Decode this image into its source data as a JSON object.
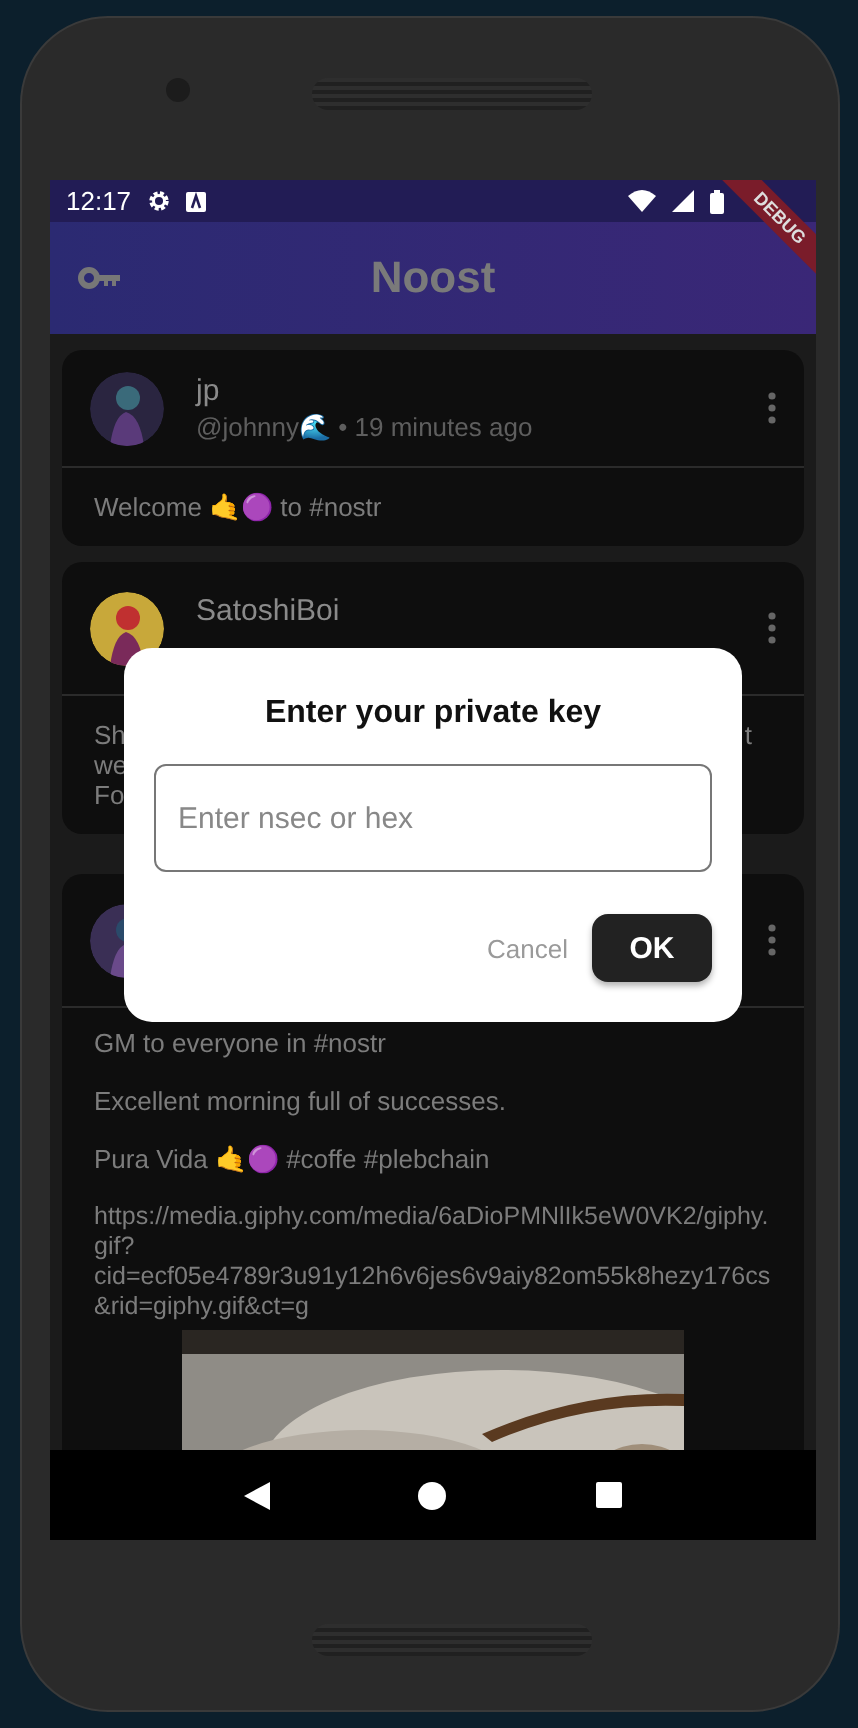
{
  "status_bar": {
    "time": "12:17"
  },
  "debug_banner": "DEBUG",
  "app_bar": {
    "title": "Noost"
  },
  "posts": [
    {
      "name": "jp",
      "meta": "@johnny🌊 • 19 minutes ago",
      "body": [
        "Welcome 🤙🟣 to #nostr"
      ]
    },
    {
      "name": "SatoshiBoi",
      "fragments": [
        {
          "left": "Sh",
          "right": "t"
        },
        {
          "left": "we"
        },
        {
          "left": "Fo"
        }
      ]
    },
    {
      "body": [
        "GM to everyone in #nostr",
        "Excellent morning full of successes.",
        "Pura Vida 🤙🟣 #coffe #plebchain",
        "https://media.giphy.com/media/6aDioPMNlIk5eW0VK2/giphy.gif?cid=ecf05e4789r3u91y12h6v6jes6v9aiy82om55k8hezy176cs&rid=giphy.gif&ct=g"
      ]
    }
  ],
  "dialog": {
    "title": "Enter your private key",
    "field": {
      "placeholder": "Enter nsec or hex"
    },
    "buttons": [
      {
        "label": "Cancel",
        "kind": "text"
      },
      {
        "label": "OK",
        "kind": "filled"
      }
    ]
  }
}
